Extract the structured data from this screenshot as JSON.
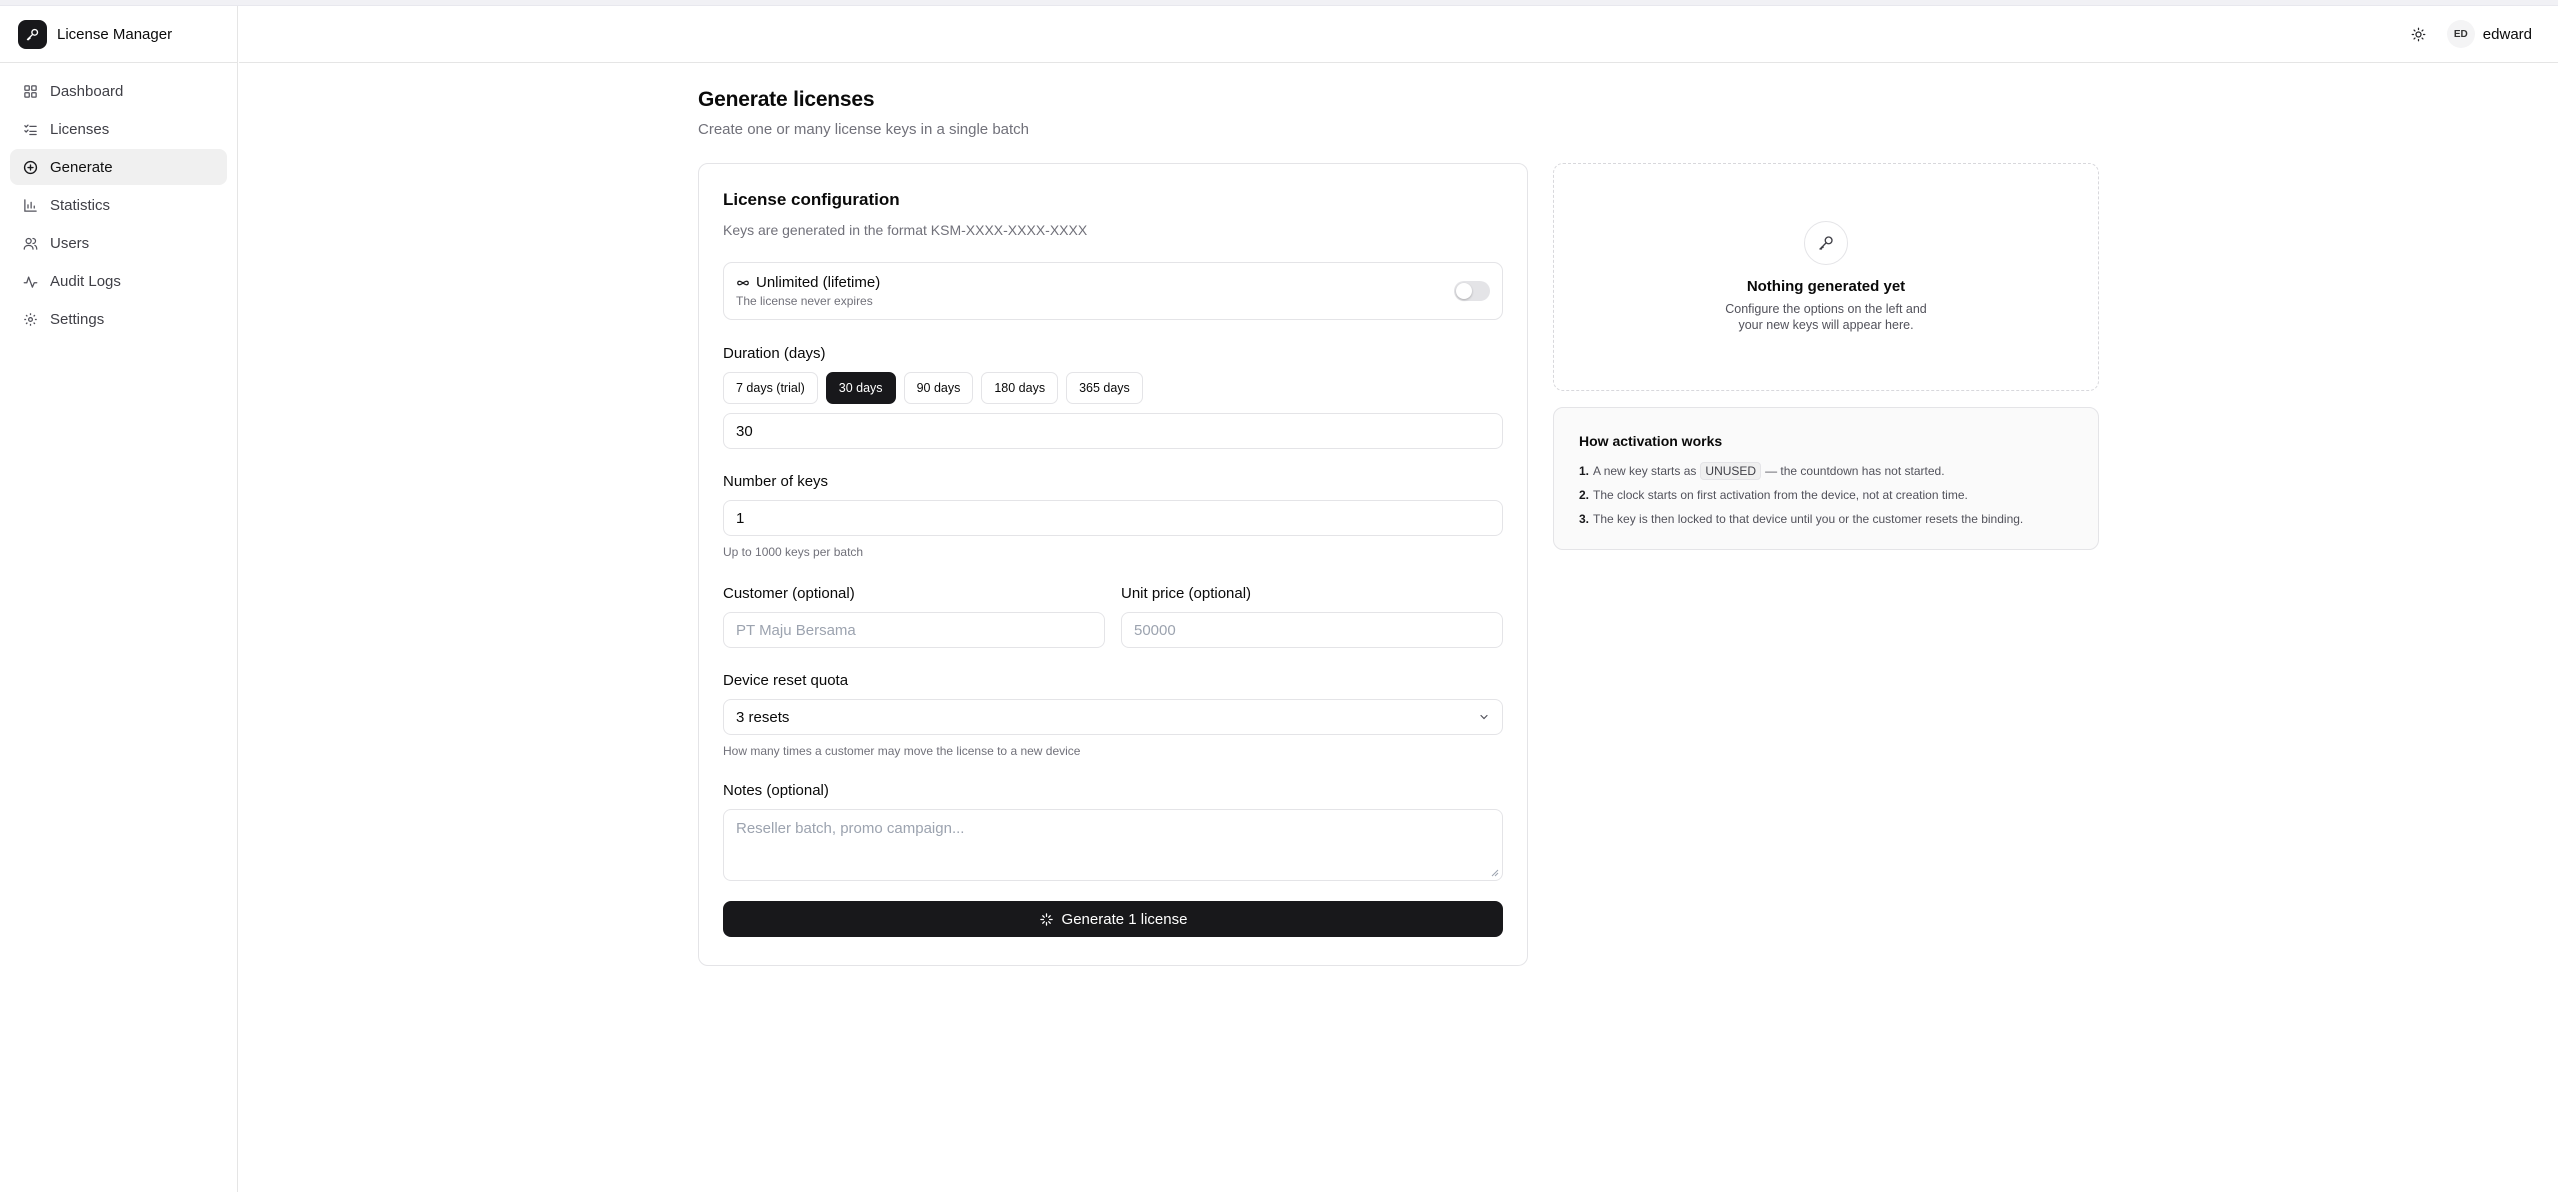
{
  "app": {
    "title": "License Manager"
  },
  "sidebar": {
    "items": [
      {
        "label": "Dashboard",
        "icon": "dashboard-icon"
      },
      {
        "label": "Licenses",
        "icon": "list-icon"
      },
      {
        "label": "Generate",
        "icon": "plus-circle-icon",
        "active": true
      },
      {
        "label": "Statistics",
        "icon": "bar-chart-icon"
      },
      {
        "label": "Users",
        "icon": "users-icon"
      },
      {
        "label": "Audit Logs",
        "icon": "activity-icon"
      },
      {
        "label": "Settings",
        "icon": "gear-icon"
      }
    ]
  },
  "header": {
    "avatar_initials": "ED",
    "username": "edward"
  },
  "page": {
    "title": "Generate licenses",
    "subtitle": "Create one or many license keys in a single batch"
  },
  "config": {
    "title": "License configuration",
    "subtitle": "Keys are generated in the format KSM-XXXX-XXXX-XXXX",
    "unlimited": {
      "title": "Unlimited (lifetime)",
      "desc": "The license never expires",
      "enabled": false
    },
    "duration": {
      "label": "Duration (days)",
      "presets": [
        "7 days (trial)",
        "30 days",
        "90 days",
        "180 days",
        "365 days"
      ],
      "selected_preset": "30 days",
      "value": "30"
    },
    "keys": {
      "label": "Number of keys",
      "value": "1",
      "hint": "Up to 1000 keys per batch"
    },
    "customer": {
      "label": "Customer (optional)",
      "placeholder": "PT Maju Bersama"
    },
    "price": {
      "label": "Unit price (optional)",
      "placeholder": "50000"
    },
    "reset_quota": {
      "label": "Device reset quota",
      "value": "3 resets",
      "hint": "How many times a customer may move the license to a new device"
    },
    "notes": {
      "label": "Notes (optional)",
      "placeholder": "Reseller batch, promo campaign..."
    },
    "generate_button": "Generate 1 license"
  },
  "empty_state": {
    "title": "Nothing generated yet",
    "text": "Configure the options on the left and your new keys will appear here."
  },
  "how": {
    "title": "How activation works",
    "steps": [
      {
        "num": "1.",
        "before": "A new key starts as",
        "code": "UNUSED",
        "after": "— the countdown has not started."
      },
      {
        "num": "2.",
        "text": "The clock starts on first activation from the device, not at creation time."
      },
      {
        "num": "3.",
        "text": "The key is then locked to that device until you or the customer resets the binding."
      }
    ]
  }
}
